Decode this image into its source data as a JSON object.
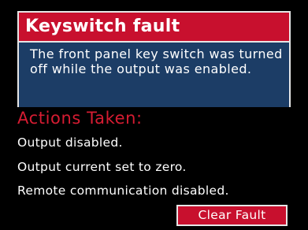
{
  "dialog": {
    "title": "Keyswitch fault",
    "description": "The front panel key switch was turned off while the output was enabled.",
    "actions_heading": "Actions Taken:",
    "actions": [
      "Output disabled.",
      "Output current set to zero.",
      "Remote communication disabled."
    ],
    "clear_button_label": "Clear Fault"
  },
  "colors": {
    "background": "#000000",
    "title_bar": "#c8102e",
    "description_panel": "#1c3d66",
    "actions_heading": "#d61c32",
    "button": "#c8102e",
    "text": "#ffffff"
  }
}
